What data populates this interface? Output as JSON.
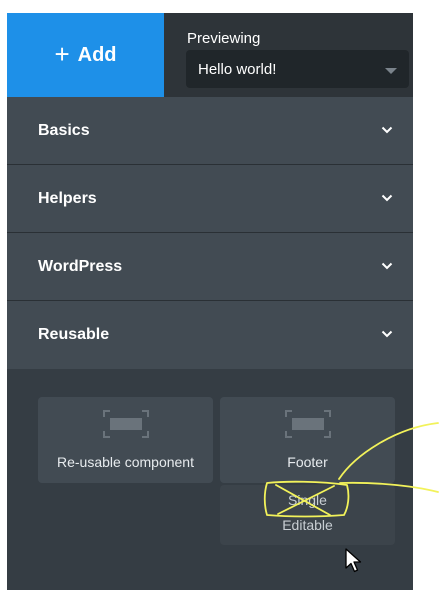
{
  "toolbar": {
    "add_label": "Add",
    "previewing_label": "Previewing",
    "preview_value": "Hello world!"
  },
  "sections": [
    {
      "label": "Basics"
    },
    {
      "label": "Helpers"
    },
    {
      "label": "WordPress"
    },
    {
      "label": "Reusable"
    }
  ],
  "components": [
    {
      "label": "Re-usable component",
      "icon": "component-placeholder-icon"
    },
    {
      "label": "Footer",
      "icon": "component-placeholder-icon"
    }
  ],
  "drag_preview": {
    "line1": "Single",
    "line2": "Editable"
  },
  "colors": {
    "accent": "#1e90e8",
    "panel": "#353d44",
    "section": "#424b53",
    "annotation": "#f2f25a"
  }
}
